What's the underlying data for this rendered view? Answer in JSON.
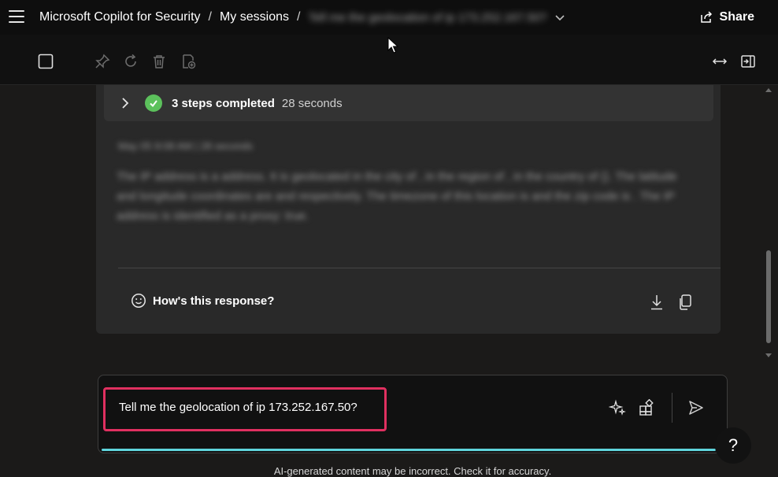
{
  "header": {
    "app_title": "Microsoft Copilot for Security",
    "sep1": "/",
    "sessions_label": "My sessions",
    "sep2": "/",
    "session_title": "Tell me the geolocation of ip 173.252.167.50?",
    "share_label": "Share"
  },
  "toolbar": {
    "icons": [
      "checkbox-icon",
      "pin-icon",
      "refresh-icon",
      "delete-icon",
      "export-icon",
      "expand-width-icon",
      "side-panel-icon"
    ]
  },
  "response": {
    "steps_label": "3 steps completed",
    "steps_duration": "28 seconds",
    "meta": "May 05 9:08 AM  |  28 seconds",
    "body": "The IP address is a address. It is geolocated in the city of , in the region of , in the country of (). The latitude and longitude coordinates are and respectively. The timezone of this location is and the zip code is . The IP address is identified as a proxy: true.",
    "feedback_label": "How's this response?"
  },
  "prompt": {
    "value": "Tell me the geolocation of ip 173.252.167.50?"
  },
  "help_label": "?",
  "footer": {
    "disclaimer": "AI-generated content may be incorrect. Check it for accuracy."
  },
  "colors": {
    "accent_cyan": "#5fd4dc",
    "success_green": "#5cc15c",
    "highlight_red": "#e03060"
  }
}
